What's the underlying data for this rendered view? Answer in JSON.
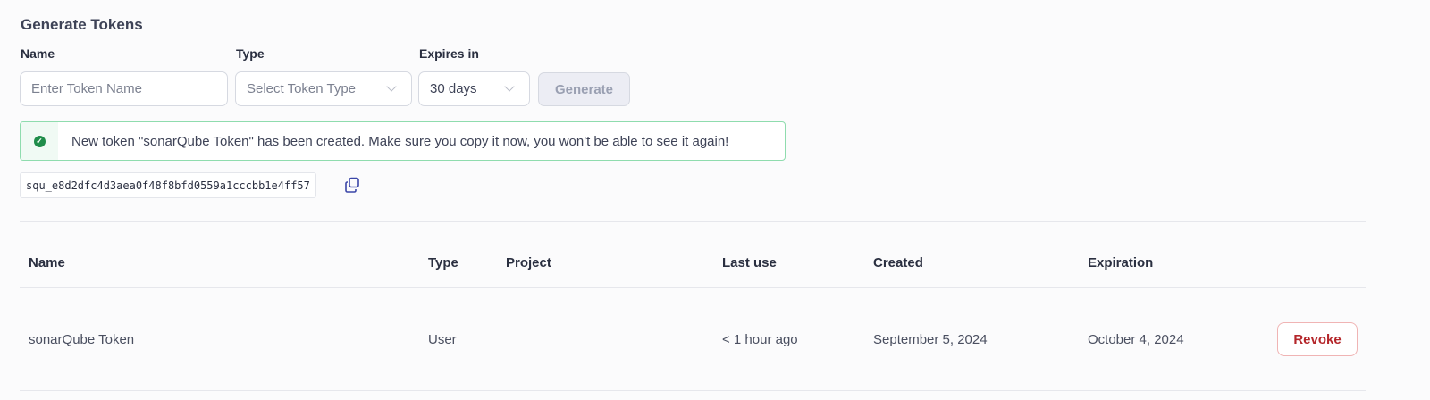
{
  "title": "Generate Tokens",
  "form": {
    "name_label": "Name",
    "name_placeholder": "Enter Token Name",
    "type_label": "Type",
    "type_placeholder": "Select Token Type",
    "expires_label": "Expires in",
    "expires_value": "30 days",
    "generate_label": "Generate"
  },
  "banner": {
    "message": "New token \"sonarQube Token\" has been created. Make sure you copy it now, you won't be able to see it again!",
    "token": "squ_e8d2dfc4d3aea0f48f8bfd0559a1cccbb1e4ff57",
    "check": "✓"
  },
  "table": {
    "headers": [
      "Name",
      "Type",
      "Project",
      "Last use",
      "Created",
      "Expiration"
    ],
    "rows": [
      {
        "name": "sonarQube Token",
        "type": "User",
        "project": "",
        "last_use": "< 1 hour ago",
        "created": "September 5, 2024",
        "expiration": "October 4, 2024",
        "action": "Revoke"
      }
    ]
  }
}
